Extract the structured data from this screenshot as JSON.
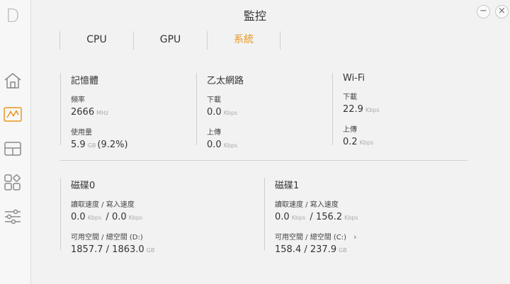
{
  "app": {
    "logo": "D",
    "title": "監控"
  },
  "window": {
    "minimize": "−",
    "close": "×"
  },
  "tabs": [
    {
      "label": "CPU"
    },
    {
      "label": "GPU"
    },
    {
      "label": "系統"
    }
  ],
  "accent_color": "#e8961e",
  "memory": {
    "title": "記憶體",
    "freq_label": "頻率",
    "freq_value": "2666",
    "freq_unit": "MHz",
    "usage_label": "使用量",
    "usage_value": "5.9",
    "usage_unit": "GB",
    "usage_percent": "(9.2%)"
  },
  "ethernet": {
    "title": "乙太網路",
    "down_label": "下載",
    "down_value": "0.0",
    "down_unit": "Kbps",
    "up_label": "上傳",
    "up_value": "0.0",
    "up_unit": "Kbps"
  },
  "wifi": {
    "title": "Wi-Fi",
    "down_label": "下載",
    "down_value": "22.9",
    "down_unit": "Kbps",
    "up_label": "上傳",
    "up_value": "0.2",
    "up_unit": "Kbps"
  },
  "disk0": {
    "title": "磁碟0",
    "rw_label": "讀取速度 / 寫入速度",
    "read_value": "0.0",
    "read_unit": "Kbps",
    "sep": "/",
    "write_value": "0.0",
    "write_unit": "Kbps",
    "space_label": "可用空間 / 總空間 (D:)",
    "free_value": "1857.7",
    "total_value": "1863.0",
    "space_unit": "GB"
  },
  "disk1": {
    "title": "磁碟1",
    "rw_label": "讀取速度 / 寫入速度",
    "read_value": "0.0",
    "read_unit": "Kbps",
    "sep": "/",
    "write_value": "156.2",
    "write_unit": "Kbps",
    "space_label": "可用空間 / 總空間 (C:)",
    "free_value": "158.4",
    "total_value": "237.9",
    "space_unit": "GB",
    "chevron": "›"
  },
  "sidebar_icons": [
    "home-icon",
    "monitor-chart-icon",
    "layout-icon",
    "apps-icon",
    "sliders-icon"
  ]
}
